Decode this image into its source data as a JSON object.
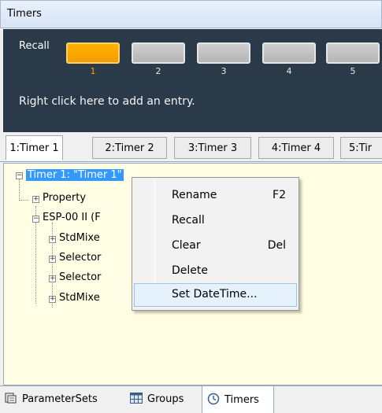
{
  "window": {
    "title": "Timers"
  },
  "recall": {
    "label": "Recall",
    "slots": [
      "1",
      "2",
      "3",
      "4",
      "5"
    ],
    "active_slot": "1",
    "hint": "Right click here to add an entry.",
    "colors": {
      "active": "#f7a600",
      "inactive": "#bfbfbf",
      "panel": "#2b3a48"
    }
  },
  "tabs": [
    {
      "label": "1:Timer 1",
      "active": true
    },
    {
      "label": "2:Timer 2",
      "active": false
    },
    {
      "label": "3:Timer 3",
      "active": false
    },
    {
      "label": "4:Timer 4",
      "active": false
    },
    {
      "label": "5:Tir",
      "active": false
    }
  ],
  "tree": {
    "root": {
      "label": "Timer 1: \"Timer 1\"",
      "expander": "minus"
    },
    "nodes": [
      {
        "label": "Property",
        "expander": "plus"
      },
      {
        "label": "ESP-00 II (F",
        "expander": "minus"
      },
      {
        "label": "StdMixe",
        "expander": "plus"
      },
      {
        "label": "Selector",
        "expander": "plus"
      },
      {
        "label": "Selector",
        "expander": "plus"
      },
      {
        "label": "StdMixe",
        "expander": "plus"
      }
    ]
  },
  "context_menu": {
    "items": [
      {
        "label": "Rename",
        "shortcut": "F2"
      },
      {
        "label": "Recall",
        "shortcut": ""
      },
      {
        "label": "Clear",
        "shortcut": "Del"
      },
      {
        "label": "Delete",
        "shortcut": ""
      },
      {
        "label": "Set DateTime...",
        "shortcut": "",
        "highlighted": true
      }
    ]
  },
  "bottom_tabs": [
    {
      "label": "ParameterSets",
      "icon": "parameter-sets-icon"
    },
    {
      "label": "Groups",
      "icon": "groups-icon"
    },
    {
      "label": "Timers",
      "icon": "clock-icon",
      "active": true
    }
  ]
}
